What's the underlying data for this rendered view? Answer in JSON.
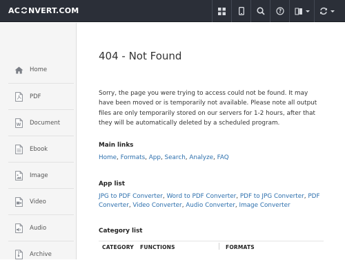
{
  "brand": {
    "logo_left": "AC",
    "logo_right": "NVERT.COM"
  },
  "topbar": {
    "buttons": [
      {
        "name": "apps-grid-icon"
      },
      {
        "name": "mobile-icon"
      },
      {
        "name": "search-icon"
      },
      {
        "name": "help-icon"
      },
      {
        "name": "language-book-icon"
      },
      {
        "name": "convert-refresh-icon"
      }
    ]
  },
  "sidebar": {
    "items": [
      {
        "label": "Home",
        "icon": "home-icon"
      },
      {
        "label": "PDF",
        "icon": "pdf-file-icon"
      },
      {
        "label": "Document",
        "icon": "document-file-icon"
      },
      {
        "label": "Ebook",
        "icon": "ebook-file-icon"
      },
      {
        "label": "Image",
        "icon": "image-file-icon"
      },
      {
        "label": "Video",
        "icon": "video-file-icon"
      },
      {
        "label": "Audio",
        "icon": "audio-file-icon"
      },
      {
        "label": "Archive",
        "icon": "archive-file-icon"
      }
    ]
  },
  "main": {
    "title": "404 - Not Found",
    "message": "Sorry, the page you were trying to access could not be found. It may have been moved or is temporarily not available. Please note all output files are only temporarily stored on our servers for 1-2 hours, after that they will be automatically deleted by a scheduled program.",
    "main_links": {
      "heading": "Main links",
      "links": [
        "Home",
        "Formats",
        "App",
        "Search",
        "Analyze",
        "FAQ"
      ]
    },
    "app_list": {
      "heading": "App list",
      "links": [
        "JPG to PDF Converter",
        "Word to PDF Converter",
        "PDF to JPG Converter",
        "PDF Converter",
        "Video Converter",
        "Audio Converter",
        "Image Converter"
      ]
    },
    "category_list": {
      "heading": "Category list",
      "columns": [
        "CATEGORY",
        "FUNCTIONS",
        "FORMATS"
      ]
    }
  }
}
